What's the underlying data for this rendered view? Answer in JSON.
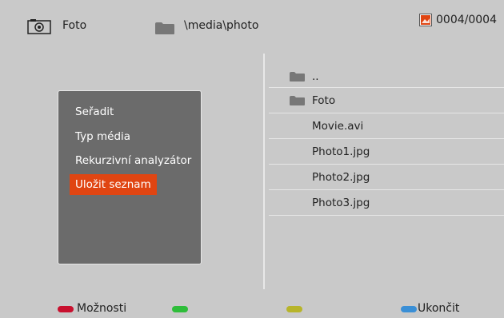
{
  "header": {
    "title": "Foto",
    "path": "\\media\\photo",
    "counter": "0004/0004"
  },
  "menu": {
    "items": [
      {
        "label": "Seřadit"
      },
      {
        "label": "Typ média"
      },
      {
        "label": "Rekurzivní analyzátor"
      },
      {
        "label": "Uložit seznam"
      }
    ],
    "selected_index": 3
  },
  "files": [
    {
      "name": "..",
      "type": "folder"
    },
    {
      "name": "Foto",
      "type": "folder"
    },
    {
      "name": "Movie.avi",
      "type": "file"
    },
    {
      "name": "Photo1.jpg",
      "type": "file"
    },
    {
      "name": "Photo2.jpg",
      "type": "file"
    },
    {
      "name": "Photo3.jpg",
      "type": "file"
    }
  ],
  "footer": {
    "red_label": "Možnosti",
    "green_label": "",
    "yellow_label": "",
    "blue_label": "Ukončit"
  },
  "colors": {
    "background": "#c9c9c9",
    "menu_panel": "#6b6b6b",
    "selected": "#e04512",
    "red": "#c8102e",
    "green": "#2ebd3a",
    "yellow": "#b7b42a",
    "blue": "#3a8fd6"
  },
  "icons": {
    "header_left": "camera-icon",
    "path": "folder-icon",
    "counter": "photo-icon",
    "file_folder": "folder-icon"
  }
}
